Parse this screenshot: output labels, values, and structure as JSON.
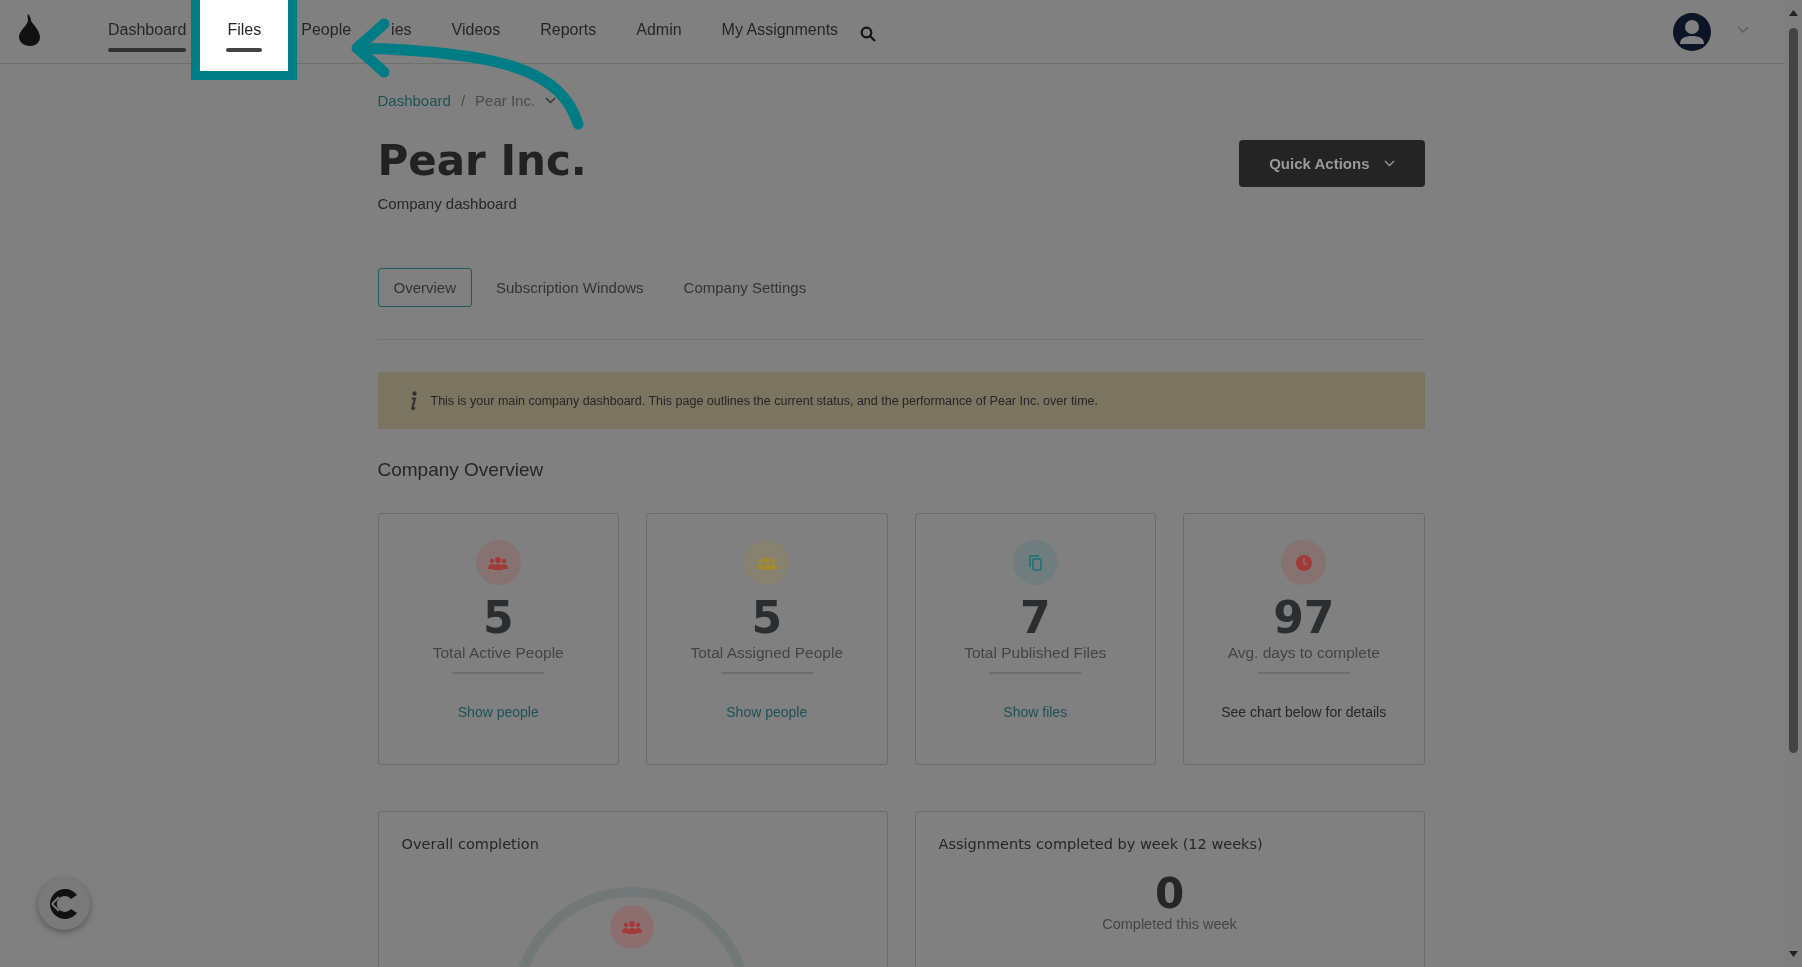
{
  "nav": {
    "items": [
      {
        "label": "Dashboard",
        "selected": true,
        "highlighted": false
      },
      {
        "label": "Files",
        "selected": true,
        "highlighted": true
      },
      {
        "label": "People",
        "selected": false,
        "highlighted": false
      },
      {
        "label": "ies",
        "selected": false,
        "highlighted": false
      },
      {
        "label": "Videos",
        "selected": false,
        "highlighted": false
      },
      {
        "label": "Reports",
        "selected": false,
        "highlighted": false
      },
      {
        "label": "Admin",
        "selected": false,
        "highlighted": false
      },
      {
        "label": "My Assignments",
        "selected": false,
        "highlighted": false
      }
    ]
  },
  "breadcrumb": {
    "items": [
      "Dashboard",
      "Pear Inc."
    ],
    "separator": "/"
  },
  "header": {
    "title": "Pear Inc.",
    "subtitle": "Company dashboard",
    "action": "Quick Actions"
  },
  "tabs": [
    {
      "label": "Overview",
      "selected": true
    },
    {
      "label": "Subscription Windows",
      "selected": false
    },
    {
      "label": "Company Settings",
      "selected": false
    }
  ],
  "notice": "This is your main company dashboard. This page outlines the current status, and the performance of Pear Inc. over time.",
  "overview": {
    "title": "Company Overview",
    "cards": [
      {
        "kind": "link",
        "color": "#a33a3a",
        "value": "5",
        "label": "Total Active People",
        "footer": "Show people"
      },
      {
        "kind": "link",
        "color": "#a38a2e",
        "value": "5",
        "label": "Total Assigned People",
        "footer": "Show people"
      },
      {
        "kind": "link",
        "color": "#2f7378",
        "value": "7",
        "label": "Total Published Files",
        "footer": "Show files"
      },
      {
        "kind": "note",
        "color": "#a33a3a",
        "value": "97",
        "label": "Avg. days to complete",
        "footer": "See chart below for details"
      }
    ]
  },
  "panels": [
    {
      "kind": "gauge",
      "title": "Overall completion"
    },
    {
      "kind": "stat",
      "title": "Assignments completed by week (12 weeks)",
      "value": "0",
      "caption": "Completed this week"
    }
  ]
}
